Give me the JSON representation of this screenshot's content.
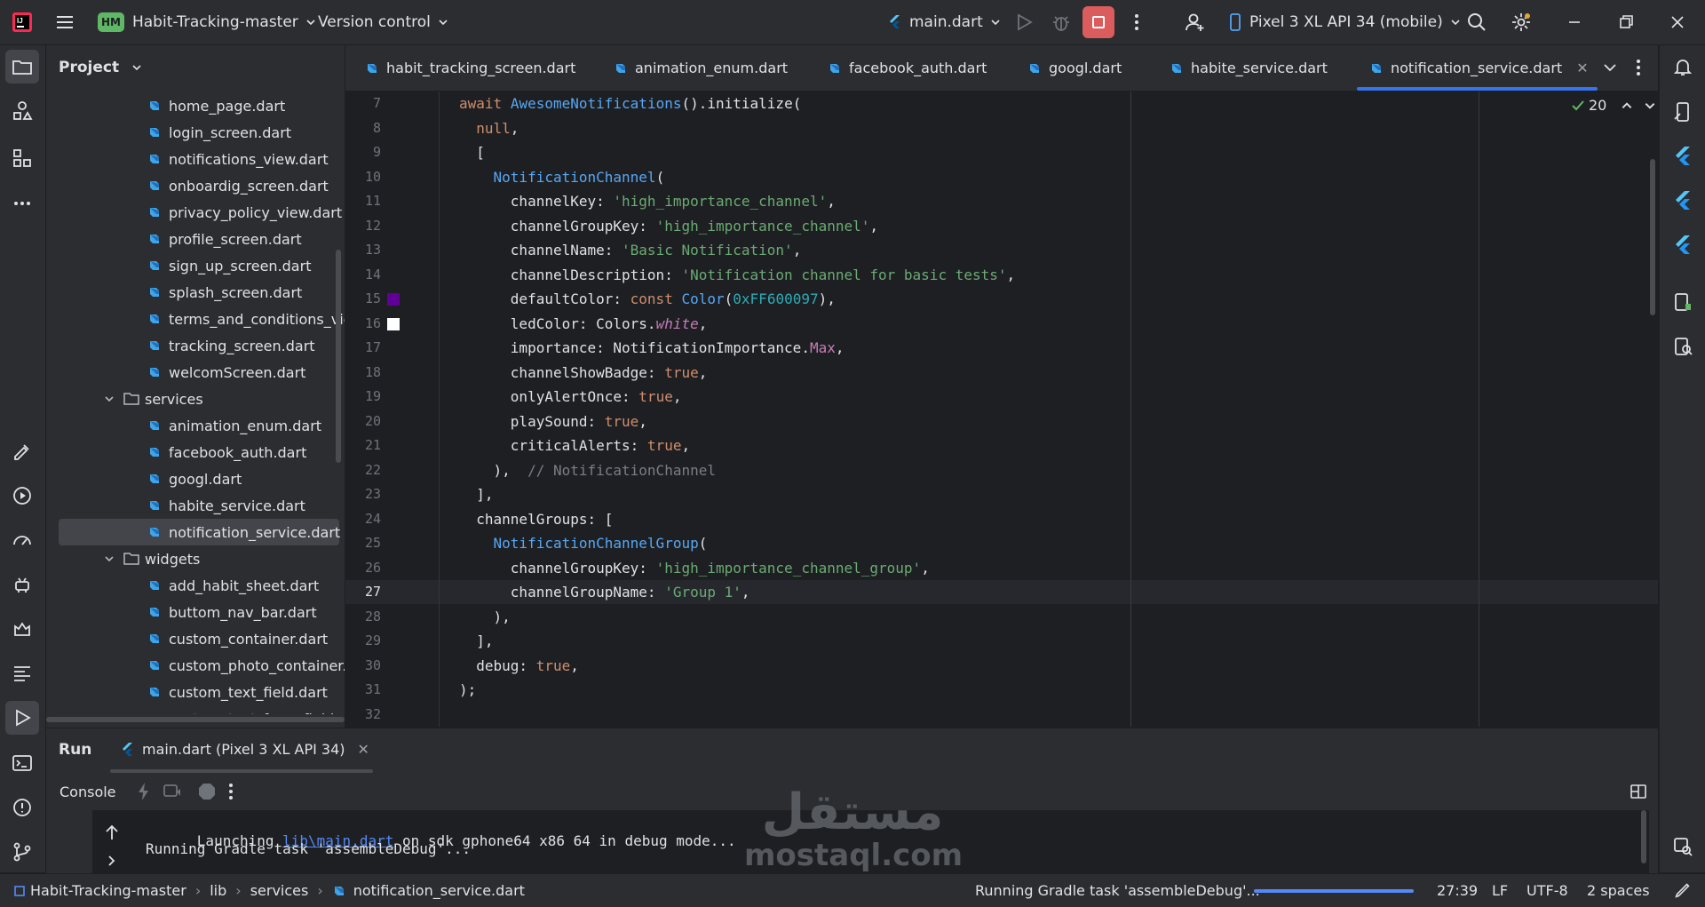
{
  "titlebar": {
    "project_badge": "HM",
    "project_name": "Habit-Tracking-master",
    "version_control": "Version control",
    "run_config": "main.dart",
    "device": "Pixel 3 XL API 34 (mobile)"
  },
  "project_panel": {
    "title": "Project",
    "rows": [
      {
        "label": "home_page.dart",
        "type": "file"
      },
      {
        "label": "login_screen.dart",
        "type": "file"
      },
      {
        "label": "notifications_view.dart",
        "type": "file"
      },
      {
        "label": "onboardig_screen.dart",
        "type": "file"
      },
      {
        "label": "privacy_policy_view.dart",
        "type": "file"
      },
      {
        "label": "profile_screen.dart",
        "type": "file"
      },
      {
        "label": "sign_up_screen.dart",
        "type": "file"
      },
      {
        "label": "splash_screen.dart",
        "type": "file"
      },
      {
        "label": "terms_and_conditions_view",
        "type": "file"
      },
      {
        "label": "tracking_screen.dart",
        "type": "file"
      },
      {
        "label": "welcomScreen.dart",
        "type": "file"
      },
      {
        "label": "services",
        "type": "folder"
      },
      {
        "label": "animation_enum.dart",
        "type": "file"
      },
      {
        "label": "facebook_auth.dart",
        "type": "file"
      },
      {
        "label": "googl.dart",
        "type": "file"
      },
      {
        "label": "habite_service.dart",
        "type": "file"
      },
      {
        "label": "notification_service.dart",
        "type": "file",
        "selected": true
      },
      {
        "label": "widgets",
        "type": "folder"
      },
      {
        "label": "add_habit_sheet.dart",
        "type": "file"
      },
      {
        "label": "buttom_nav_bar.dart",
        "type": "file"
      },
      {
        "label": "custom_container.dart",
        "type": "file"
      },
      {
        "label": "custom_photo_container.c",
        "type": "file"
      },
      {
        "label": "custom_text_field.dart",
        "type": "file"
      },
      {
        "label": "custom_text_form_field.da",
        "type": "file"
      }
    ]
  },
  "tabs": [
    {
      "label": "habit_tracking_screen.dart"
    },
    {
      "label": "animation_enum.dart"
    },
    {
      "label": "facebook_auth.dart"
    },
    {
      "label": "googl.dart"
    },
    {
      "label": "habite_service.dart"
    },
    {
      "label": "notification_service.dart",
      "active": true
    }
  ],
  "editor": {
    "inspection_count": "20",
    "current_line": "27",
    "swatch_colors": {
      "line15": "#600097",
      "line16": "#ffffff"
    },
    "lines": [
      {
        "n": "7",
        "html": "<span class=\"k\">await</span> <span class=\"f\">AwesomeNotifications</span>().initialize("
      },
      {
        "n": "8",
        "html": "  <span class=\"k\">null</span>,"
      },
      {
        "n": "9",
        "html": "  ["
      },
      {
        "n": "10",
        "html": "    <span class=\"f\">NotificationChannel</span>("
      },
      {
        "n": "11",
        "html": "      channelKey: <span class=\"s\">'high_importance_channel'</span>,"
      },
      {
        "n": "12",
        "html": "      channelGroupKey: <span class=\"s\">'high_importance_channel'</span>,"
      },
      {
        "n": "13",
        "html": "      channelName: <span class=\"s\">'Basic Notification'</span>,"
      },
      {
        "n": "14",
        "html": "      channelDescription: <span class=\"s\">'Notification channel for basic tests'</span>,"
      },
      {
        "n": "15",
        "html": "      defaultColor: <span class=\"k\">const</span> <span class=\"f\">Color</span>(<span class=\"n\">0xFF600097</span>),"
      },
      {
        "n": "16",
        "html": "      ledColor: Colors.<span class=\"it\">white</span>,"
      },
      {
        "n": "17",
        "html": "      importance: NotificationImportance.<span class=\"p\">Max</span>,"
      },
      {
        "n": "18",
        "html": "      channelShowBadge: <span class=\"k\">true</span>,"
      },
      {
        "n": "19",
        "html": "      onlyAlertOnce: <span class=\"k\">true</span>,"
      },
      {
        "n": "20",
        "html": "      playSound: <span class=\"k\">true</span>,"
      },
      {
        "n": "21",
        "html": "      criticalAlerts: <span class=\"k\">true</span>,"
      },
      {
        "n": "22",
        "html": "    ),  <span class=\"c\">// NotificationChannel</span>"
      },
      {
        "n": "23",
        "html": "  ],"
      },
      {
        "n": "24",
        "html": "  channelGroups: ["
      },
      {
        "n": "25",
        "html": "    <span class=\"f\">NotificationChannelGroup</span>("
      },
      {
        "n": "26",
        "html": "      channelGroupKey: <span class=\"s\">'high_importance_channel_group'</span>,"
      },
      {
        "n": "27",
        "html": "      channelGroupName: <span class=\"s\">'Group 1'</span>,"
      },
      {
        "n": "28",
        "html": "    ),"
      },
      {
        "n": "29",
        "html": "  ],"
      },
      {
        "n": "30",
        "html": "  debug: <span class=\"k\">true</span>,"
      },
      {
        "n": "31",
        "html": ");"
      },
      {
        "n": "32",
        "html": ""
      }
    ]
  },
  "run_panel": {
    "title": "Run",
    "tab_label": "main.dart (Pixel 3 XL API 34)",
    "console_label": "Console",
    "console_lines": {
      "line1_prefix": "Launching ",
      "line1_link": "lib\\main.dart",
      "line1_suffix": " on sdk gphone64 x86 64 in debug mode...",
      "line2": "Running Gradle task 'assembleDebug'..."
    }
  },
  "statusbar": {
    "breadcrumb": [
      "Habit-Tracking-master",
      "lib",
      "services",
      "notification_service.dart"
    ],
    "task": "Running Gradle task 'assembleDebug'...",
    "progress": 1.0,
    "position": "27:39",
    "line_sep": "LF",
    "encoding": "UTF-8",
    "indent": "2 spaces"
  },
  "watermark": {
    "arabic": "مستقل",
    "latin": "mostaql.com"
  }
}
